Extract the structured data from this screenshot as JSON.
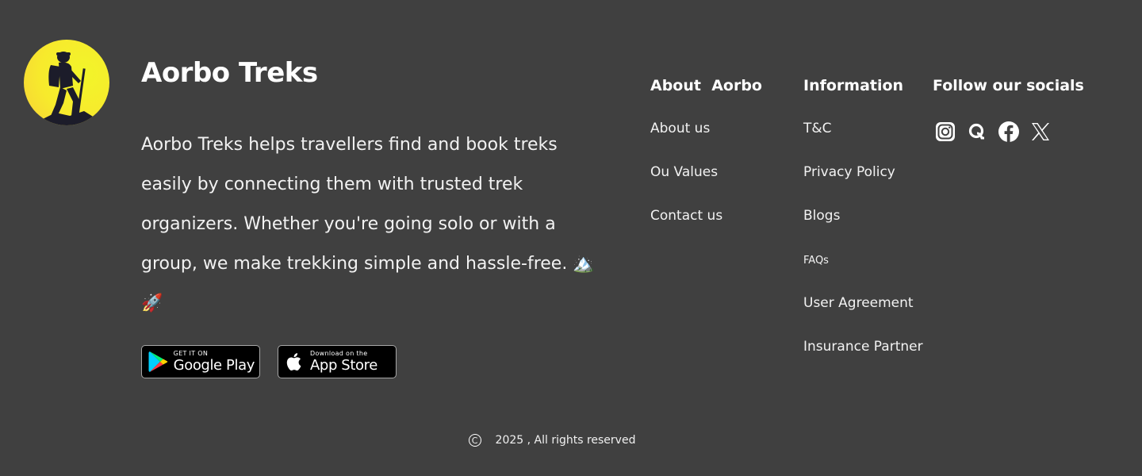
{
  "brand": {
    "name": "Aorbo Treks",
    "description": "Aorbo Treks helps travellers find and book treks easily by connecting them with trusted trek organizers. Whether you're going solo or with a group, we make trekking simple and hassle-free. 🏔️🚀",
    "logo_icon": "hiker-logo-icon"
  },
  "stores": {
    "google": {
      "small": "GET IT ON",
      "big": "Google Play",
      "icon": "google-play-icon"
    },
    "apple": {
      "small": "Download on the",
      "big": "App Store",
      "icon": "apple-icon"
    }
  },
  "about": {
    "heading": "About  Aorbo",
    "links": [
      "About us",
      "Ou Values",
      "Contact us"
    ]
  },
  "info": {
    "heading": "Information",
    "links": [
      "T&C",
      "Privacy Policy",
      "Blogs",
      "FAQs",
      "User Agreement",
      "Insurance Partner"
    ]
  },
  "social": {
    "heading": "Follow our socials",
    "icons": [
      "instagram-icon",
      "quora-icon",
      "facebook-icon",
      "x-icon"
    ]
  },
  "footer": {
    "copyright_symbol": "C",
    "text": "2025 , All rights reserved"
  },
  "colors": {
    "background": "#404040",
    "logo_yellow": "#f5ef2b",
    "text": "#ffffff"
  }
}
